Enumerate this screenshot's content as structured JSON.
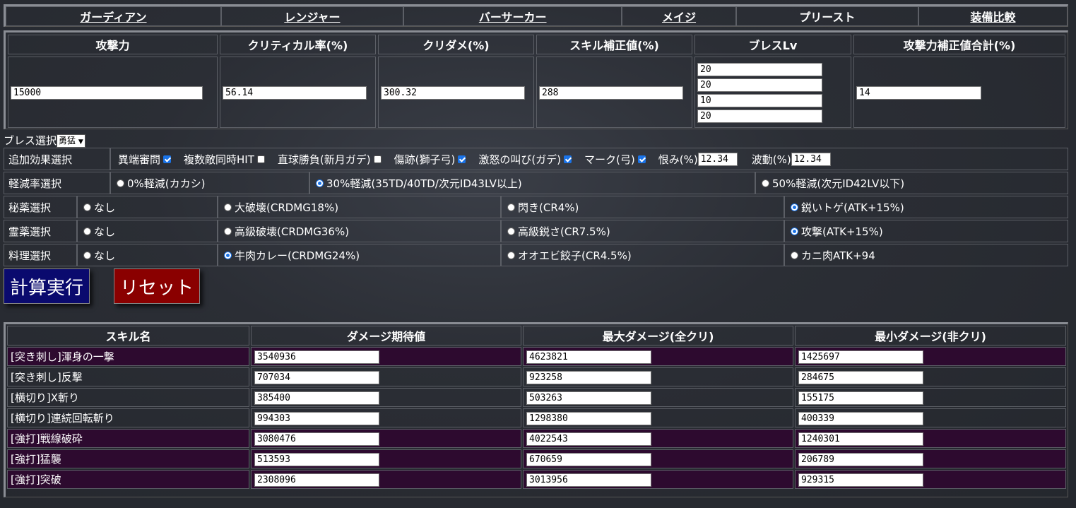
{
  "nav": [
    {
      "label": "ガーディアン",
      "link": true
    },
    {
      "label": "レンジャー",
      "link": true
    },
    {
      "label": "バーサーカー",
      "link": true
    },
    {
      "label": "メイジ",
      "link": true
    },
    {
      "label": "プリースト",
      "link": false
    },
    {
      "label": "装備比較",
      "link": true
    }
  ],
  "stats": {
    "headers": [
      "攻撃力",
      "クリティカル率(%)",
      "クリダメ(%)",
      "スキル補正値(%)",
      "ブレスLv",
      "攻撃力補正値合計(%)"
    ],
    "attack": "15000",
    "crit_rate": "56.14",
    "crit_damage": "300.32",
    "skill_mod": "288",
    "bless_lv": [
      "20",
      "20",
      "10",
      "20"
    ],
    "atk_mod_total": "14"
  },
  "bless_select": {
    "label": "ブレス選択",
    "value": "勇猛"
  },
  "effects": {
    "label": "追加効果選択",
    "items": [
      {
        "label": "異端審問",
        "checked": true
      },
      {
        "label": "複数敵同時HIT",
        "checked": false
      },
      {
        "label": "直球勝負(新月ガデ)",
        "checked": false
      },
      {
        "label": "傷跡(獅子弓)",
        "checked": true
      },
      {
        "label": "激怒の叫び(ガデ)",
        "checked": true
      },
      {
        "label": "マーク(弓)",
        "checked": true
      }
    ],
    "grudge_label": "恨み(%)",
    "grudge_value": "12.34",
    "wave_label": "波動(%)",
    "wave_value": "12.34"
  },
  "reduction": {
    "label": "軽減率選択",
    "options": [
      {
        "label": "0%軽減(カカシ)",
        "selected": false
      },
      {
        "label": "30%軽減(35TD/40TD/次元ID43LV以上)",
        "selected": true
      },
      {
        "label": "50%軽減(次元ID42LV以下)",
        "selected": false
      }
    ]
  },
  "secret": {
    "label": "秘薬選択",
    "options": [
      {
        "label": "なし",
        "selected": false
      },
      {
        "label": "大破壊(CRDMG18%)",
        "selected": false
      },
      {
        "label": "閃き(CR4%)",
        "selected": false
      },
      {
        "label": "鋭いトゲ(ATK+15%)",
        "selected": true
      }
    ]
  },
  "spirit": {
    "label": "霊薬選択",
    "options": [
      {
        "label": "なし",
        "selected": false
      },
      {
        "label": "高級破壊(CRDMG36%)",
        "selected": false
      },
      {
        "label": "高級鋭さ(CR7.5%)",
        "selected": false
      },
      {
        "label": "攻撃(ATK+15%)",
        "selected": true
      }
    ]
  },
  "cooking": {
    "label": "料理選択",
    "options": [
      {
        "label": "なし",
        "selected": false
      },
      {
        "label": "牛肉カレー(CRDMG24%)",
        "selected": true
      },
      {
        "label": "オオエビ餃子(CR4.5%)",
        "selected": false
      },
      {
        "label": "カニ肉ATK+94",
        "selected": false
      }
    ]
  },
  "buttons": {
    "calc": "計算実行",
    "reset": "リセット"
  },
  "results": {
    "headers": [
      "スキル名",
      "ダメージ期待値",
      "最大ダメージ(全クリ)",
      "最小ダメージ(非クリ)"
    ],
    "rows": [
      {
        "name": "[突き刺し]渾身の一撃",
        "expected": "3540936",
        "max": "4623821",
        "min": "1425697",
        "highlight": true
      },
      {
        "name": "[突き刺し]反撃",
        "expected": "707034",
        "max": "923258",
        "min": "284675",
        "highlight": false
      },
      {
        "name": "[横切り]X斬り",
        "expected": "385400",
        "max": "503263",
        "min": "155175",
        "highlight": false
      },
      {
        "name": "[横切り]連続回転斬り",
        "expected": "994303",
        "max": "1298380",
        "min": "400339",
        "highlight": false
      },
      {
        "name": "[強打]戦線破砕",
        "expected": "3080476",
        "max": "4022543",
        "min": "1240301",
        "highlight": true
      },
      {
        "name": "[強打]猛襲",
        "expected": "513593",
        "max": "670659",
        "min": "206789",
        "highlight": true
      },
      {
        "name": "[強打]突破",
        "expected": "2308096",
        "max": "3013956",
        "min": "929315",
        "highlight": true
      }
    ]
  },
  "colors": {
    "calc_button": "#0a0a6e",
    "reset_button": "#8a0000",
    "highlight_row": "#2d0a2f",
    "checkbox": "#1a73e8"
  }
}
